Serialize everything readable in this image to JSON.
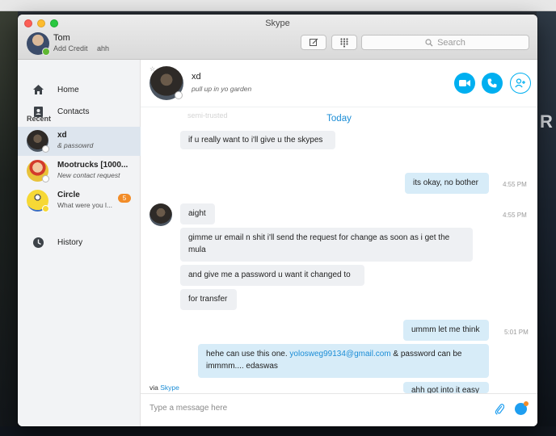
{
  "window": {
    "title": "Skype"
  },
  "desktop": {
    "right_text": "R"
  },
  "profile": {
    "name": "Tom",
    "credit": "Add Credit",
    "mood": "ahh",
    "status_color": "#5fb832"
  },
  "toolbar": {
    "compose_icon": "compose-icon",
    "dialpad_icon": "dialpad-icon",
    "search_placeholder": "Search"
  },
  "sidebar": {
    "nav": [
      {
        "label": "Home",
        "icon": "home-icon"
      },
      {
        "label": "Contacts",
        "icon": "contacts-icon"
      }
    ],
    "recent_label": "Recent",
    "recents": [
      {
        "name": "xd",
        "subtitle": "& passowrd",
        "active": true
      },
      {
        "name": "Mootrucks [1000...",
        "subtitle": "New contact request"
      },
      {
        "name": "Circle",
        "subtitle": "What were you l...",
        "badge": "5"
      }
    ],
    "history": {
      "label": "History",
      "icon": "history-icon"
    }
  },
  "chat": {
    "contact_name": "xd",
    "contact_mood": "pull up in yo garden",
    "faded_text": "semi-trusted",
    "date_label": "Today",
    "messages": [
      {
        "dir": "in",
        "text": "if u really want to i'll give u the skypes"
      },
      {
        "dir": "out",
        "text": "its okay, no bother",
        "time": "4:55 PM"
      },
      {
        "dir": "in",
        "text": "aight",
        "time": "4:55 PM"
      },
      {
        "dir": "in",
        "text": "gimme ur email n shit i'll send the request for change as soon as i get the mula"
      },
      {
        "dir": "in",
        "text": "and give me a password u want it changed to"
      },
      {
        "dir": "in",
        "text": "for transfer"
      },
      {
        "dir": "out",
        "text": "ummm let me think",
        "time": "5:01 PM"
      },
      {
        "dir": "out",
        "text_before": "hehe can use this one. ",
        "email": "yolosweg99134@gmail.com",
        "text_after": " & password can be immmm.... edaswas"
      },
      {
        "dir": "out",
        "text": "ahh got into it easy"
      }
    ],
    "via_prefix": "via ",
    "via_link": "Skype",
    "composer_placeholder": "Type a message here"
  },
  "colors": {
    "accent": "#00aff0",
    "link": "#1b8dd6",
    "badge": "#f28c28",
    "out_bubble": "#d7ecf8",
    "in_bubble": "#eef0f3"
  }
}
